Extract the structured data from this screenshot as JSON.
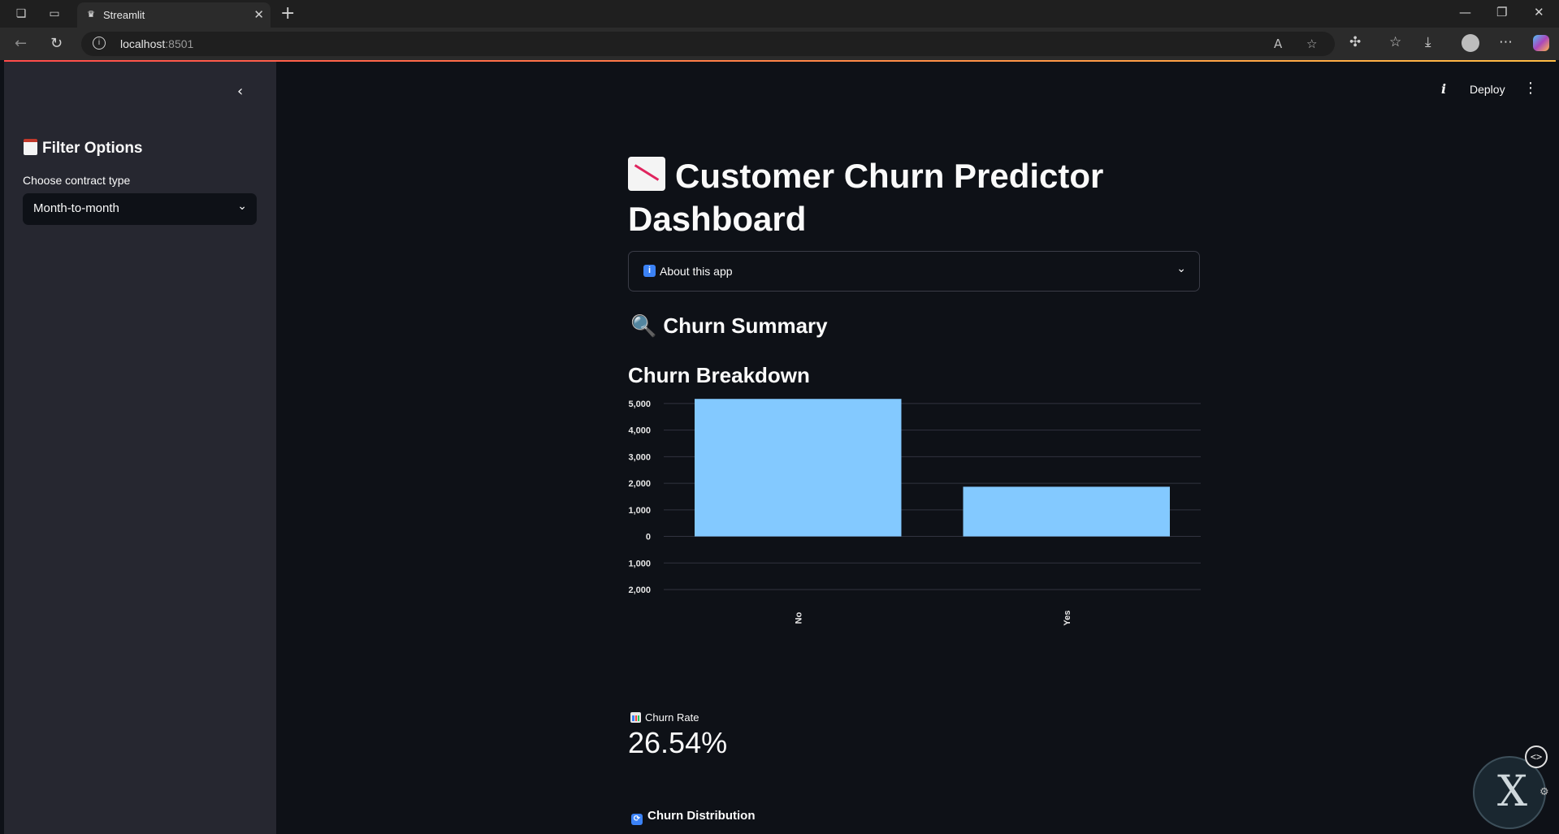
{
  "browser": {
    "tab_title": "Streamlit",
    "url_host": "localhost",
    "url_port": ":8501"
  },
  "sidebar": {
    "title": "Filter Options",
    "title_icon": "clipboard-icon",
    "select_label": "Choose contract type",
    "select_value": "Month-to-month"
  },
  "toolbar": {
    "deploy_label": "Deploy"
  },
  "main": {
    "title": "Customer Churn Predictor Dashboard",
    "title_icon": "chart-decreasing-icon",
    "expander_label": "About this app",
    "summary_heading": "Churn Summary",
    "breakdown_heading": "Churn Breakdown",
    "metric_label": "Churn Rate",
    "metric_value": "26.54%",
    "distribution_heading": "Churn Distribution"
  },
  "colors": {
    "accent": "#ff4b4b",
    "bar": "#83c9ff",
    "background": "#0e1117",
    "sidebar": "#262730"
  },
  "chart_data": {
    "type": "bar",
    "categories": [
      "No",
      "Yes"
    ],
    "values": [
      5174,
      1869
    ],
    "ytick_labels": [
      "5,000",
      "4,000",
      "3,000",
      "2,000",
      "1,000",
      "0",
      "1,000",
      "2,000"
    ],
    "ylim": [
      -2000,
      5000
    ],
    "grid": true
  }
}
